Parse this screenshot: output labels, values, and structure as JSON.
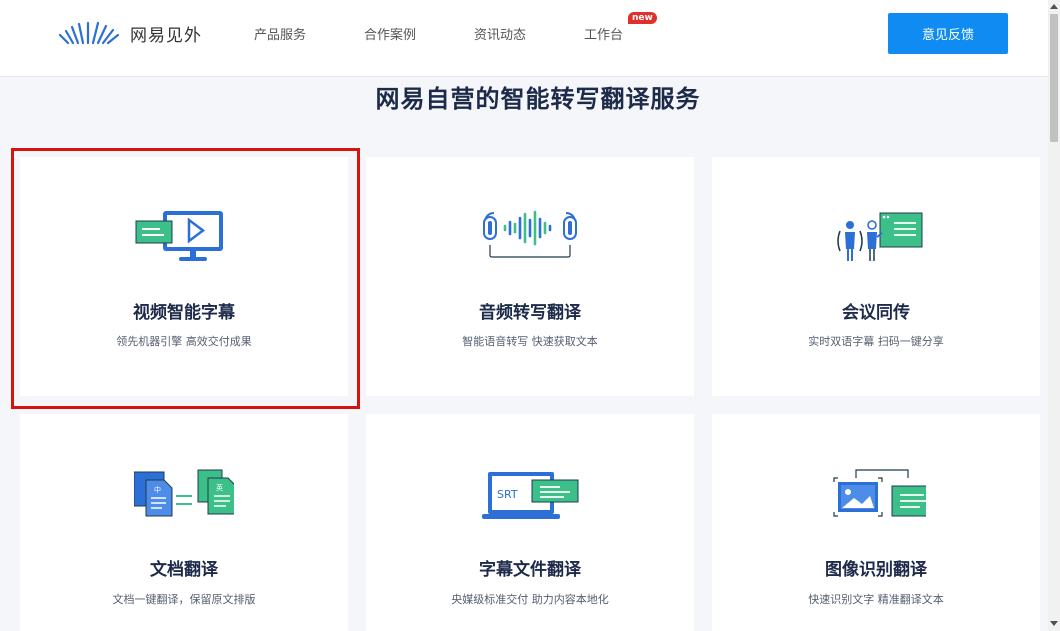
{
  "header": {
    "logo_text": "网易见外",
    "nav": [
      "产品服务",
      "合作案例",
      "资讯动态",
      "工作台"
    ],
    "new_badge": "new",
    "feedback_button": "意见反馈"
  },
  "main": {
    "title": "网易自营的智能转写翻译服务",
    "cards": [
      {
        "title": "视频智能字幕",
        "subtitle": "领先机器引擎 高效交付成果",
        "icon": "video-monitor-icon"
      },
      {
        "title": "音频转写翻译",
        "subtitle": "智能语音转写 快速获取文本",
        "icon": "headphones-waveform-icon"
      },
      {
        "title": "会议同传",
        "subtitle": "实时双语字幕 扫码一键分享",
        "icon": "meeting-people-icon"
      },
      {
        "title": "文档翻译",
        "subtitle": "文档一键翻译，保留原文排版",
        "icon": "document-translate-icon",
        "doc_labels": [
          "中",
          "英"
        ]
      },
      {
        "title": "字幕文件翻译",
        "subtitle": "央媒级标准交付 助力内容本地化",
        "icon": "laptop-srt-icon",
        "srt_label": "SRT"
      },
      {
        "title": "图像识别翻译",
        "subtitle": "快速识别文字 精准翻译文本",
        "icon": "image-recognition-icon"
      }
    ]
  },
  "colors": {
    "brand_blue": "#2c6fd6",
    "brand_green": "#3dbf8a",
    "button_blue": "#0f8bf2",
    "highlight_red": "#d8120c",
    "title_dark": "#1d2a4a"
  }
}
